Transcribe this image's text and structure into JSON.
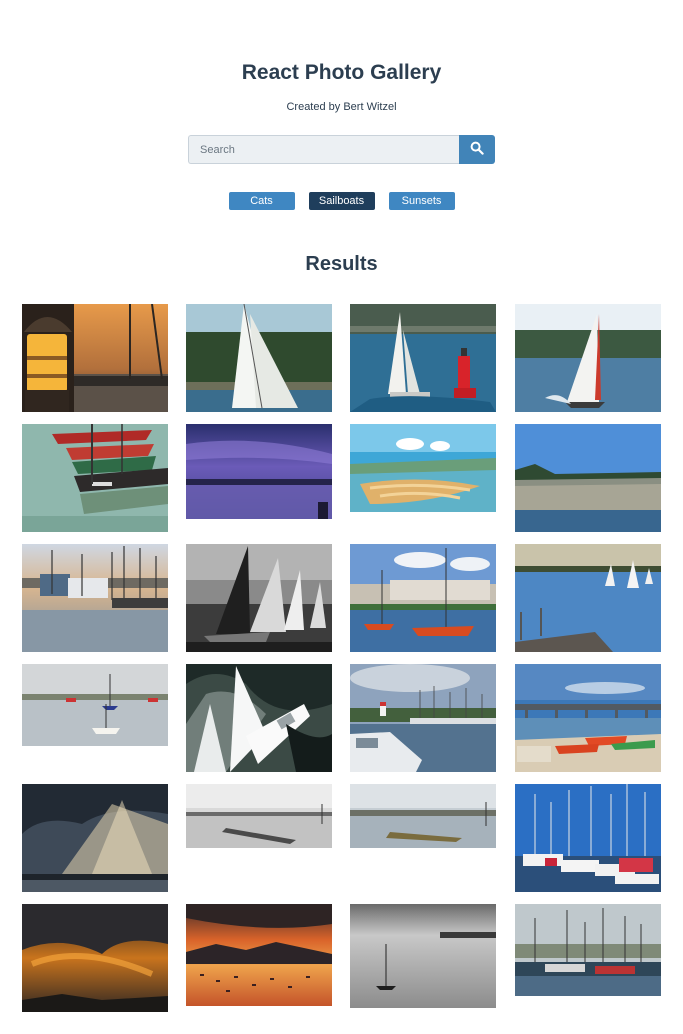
{
  "header": {
    "title": "React Photo Gallery",
    "subtitle": "Created by Bert Witzel"
  },
  "search": {
    "placeholder": "Search",
    "button_icon": "search-icon"
  },
  "nav": {
    "items": [
      {
        "label": "Cats",
        "active": false
      },
      {
        "label": "Sailboats",
        "active": true
      },
      {
        "label": "Sunsets",
        "active": false
      }
    ]
  },
  "results": {
    "title": "Results"
  },
  "colors": {
    "accent": "#3f87c2",
    "active": "#1f3e5c",
    "text": "#2c3e50"
  }
}
